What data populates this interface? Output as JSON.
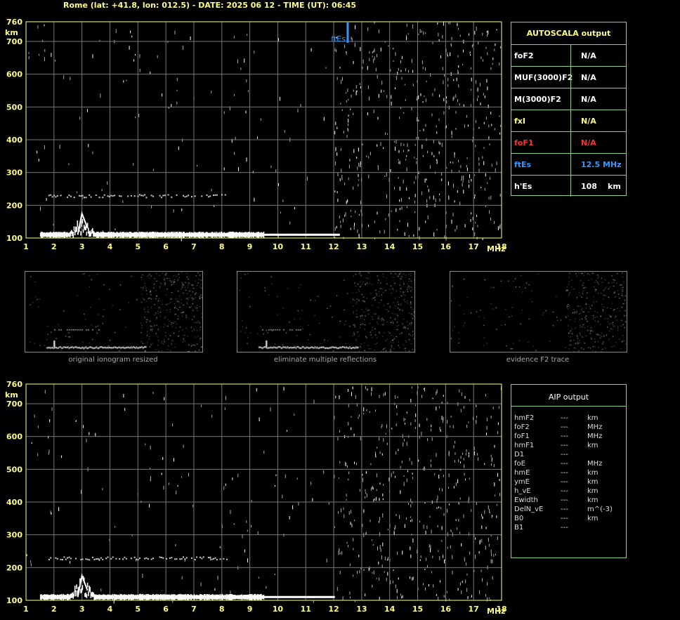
{
  "header": {
    "title": "Rome (lat: +41.8, lon: 012.5) - DATE: 2025 06 12 - TIME (UT): 06:45"
  },
  "chart_data": [
    {
      "type": "scatter",
      "title": "",
      "xlabel": "MHz",
      "ylabel": "km",
      "xlim": [
        1,
        18
      ],
      "ylim": [
        100,
        760
      ],
      "x_ticks": [
        "1",
        "2",
        "3",
        "4",
        "5",
        "6",
        "7",
        "8",
        "9",
        "10",
        "11",
        "12",
        "13",
        "14",
        "15",
        "16",
        "17",
        "18"
      ],
      "y_ticks": [
        "100",
        "200",
        "300",
        "400",
        "500",
        "600",
        "700",
        "760"
      ],
      "grid": true,
      "annotation": {
        "label": "ftEs",
        "x": 12.5
      },
      "traces": {
        "es_trace": {
          "x_start": 1.5,
          "x_end": 12.2,
          "height_km": 110,
          "peak": {
            "x": 3.0,
            "height_km": 175
          }
        },
        "multiple_echo": {
          "x_start": 1.8,
          "x_end": 8.2,
          "height_km": 230
        }
      }
    },
    {
      "type": "scatter",
      "title": "",
      "xlabel": "MHz",
      "ylabel": "km",
      "xlim": [
        1,
        18
      ],
      "ylim": [
        100,
        760
      ],
      "x_ticks": [
        "1",
        "2",
        "3",
        "4",
        "5",
        "6",
        "7",
        "8",
        "9",
        "10",
        "11",
        "12",
        "13",
        "14",
        "15",
        "16",
        "17",
        "18"
      ],
      "y_ticks": [
        "100",
        "200",
        "300",
        "400",
        "500",
        "600",
        "700",
        "760"
      ],
      "grid": true,
      "traces": {
        "es_trace": {
          "x_start": 1.5,
          "x_end": 12.0,
          "height_km": 110,
          "peak": {
            "x": 3.0,
            "height_km": 175
          }
        },
        "multiple_echo": {
          "x_start": 1.8,
          "x_end": 8.2,
          "height_km": 230
        }
      }
    }
  ],
  "autoscala": {
    "title": "AUTOSCALA output",
    "rows": [
      {
        "key": "foF2",
        "value": "N/A",
        "unit": "",
        "color": "#ffffff"
      },
      {
        "key": "MUF(3000)F2",
        "value": "N/A",
        "unit": "",
        "color": "#ffffff"
      },
      {
        "key": "M(3000)F2",
        "value": "N/A",
        "unit": "",
        "color": "#ffffff"
      },
      {
        "key": "fxI",
        "value": "N/A",
        "unit": "",
        "color": "#ffff80"
      },
      {
        "key": "foF1",
        "value": "N/A",
        "unit": "",
        "color": "#ff3030"
      },
      {
        "key": "ftEs",
        "value": "12.5 MHz",
        "unit": "",
        "color": "#3399ff"
      },
      {
        "key": "h'Es",
        "value": "108",
        "unit": "km",
        "color": "#ffffff"
      }
    ]
  },
  "thumbnails": [
    {
      "caption": "original ionogram resized"
    },
    {
      "caption": "eliminate multiple reflections"
    },
    {
      "caption": "evidence F2 trace"
    }
  ],
  "aip": {
    "title": "AIP output",
    "rows": [
      {
        "key": "hmF2",
        "value": "---",
        "unit": "km"
      },
      {
        "key": "foF2",
        "value": "---",
        "unit": "MHz"
      },
      {
        "key": "foF1",
        "value": "---",
        "unit": "MHz"
      },
      {
        "key": "hmF1",
        "value": "---",
        "unit": "km"
      },
      {
        "key": "D1",
        "value": "---",
        "unit": ""
      },
      {
        "key": "foE",
        "value": "---",
        "unit": "MHz"
      },
      {
        "key": "hmE",
        "value": "---",
        "unit": "km"
      },
      {
        "key": "ymE",
        "value": "---",
        "unit": "km"
      },
      {
        "key": "h_vE",
        "value": "---",
        "unit": "km"
      },
      {
        "key": "Ewidth",
        "value": "---",
        "unit": "km"
      },
      {
        "key": "DelN_vE",
        "value": "---",
        "unit": "m^(-3)"
      },
      {
        "key": "B0",
        "value": "---",
        "unit": "km"
      },
      {
        "key": "B1",
        "value": "---",
        "unit": ""
      }
    ]
  },
  "colors": {
    "axis": "#ffff80",
    "grid": "#777777",
    "frame": "#8fd08f",
    "trace": "#ffffff",
    "noise": "#aaaaaa",
    "ftEs": "#3399ff"
  }
}
